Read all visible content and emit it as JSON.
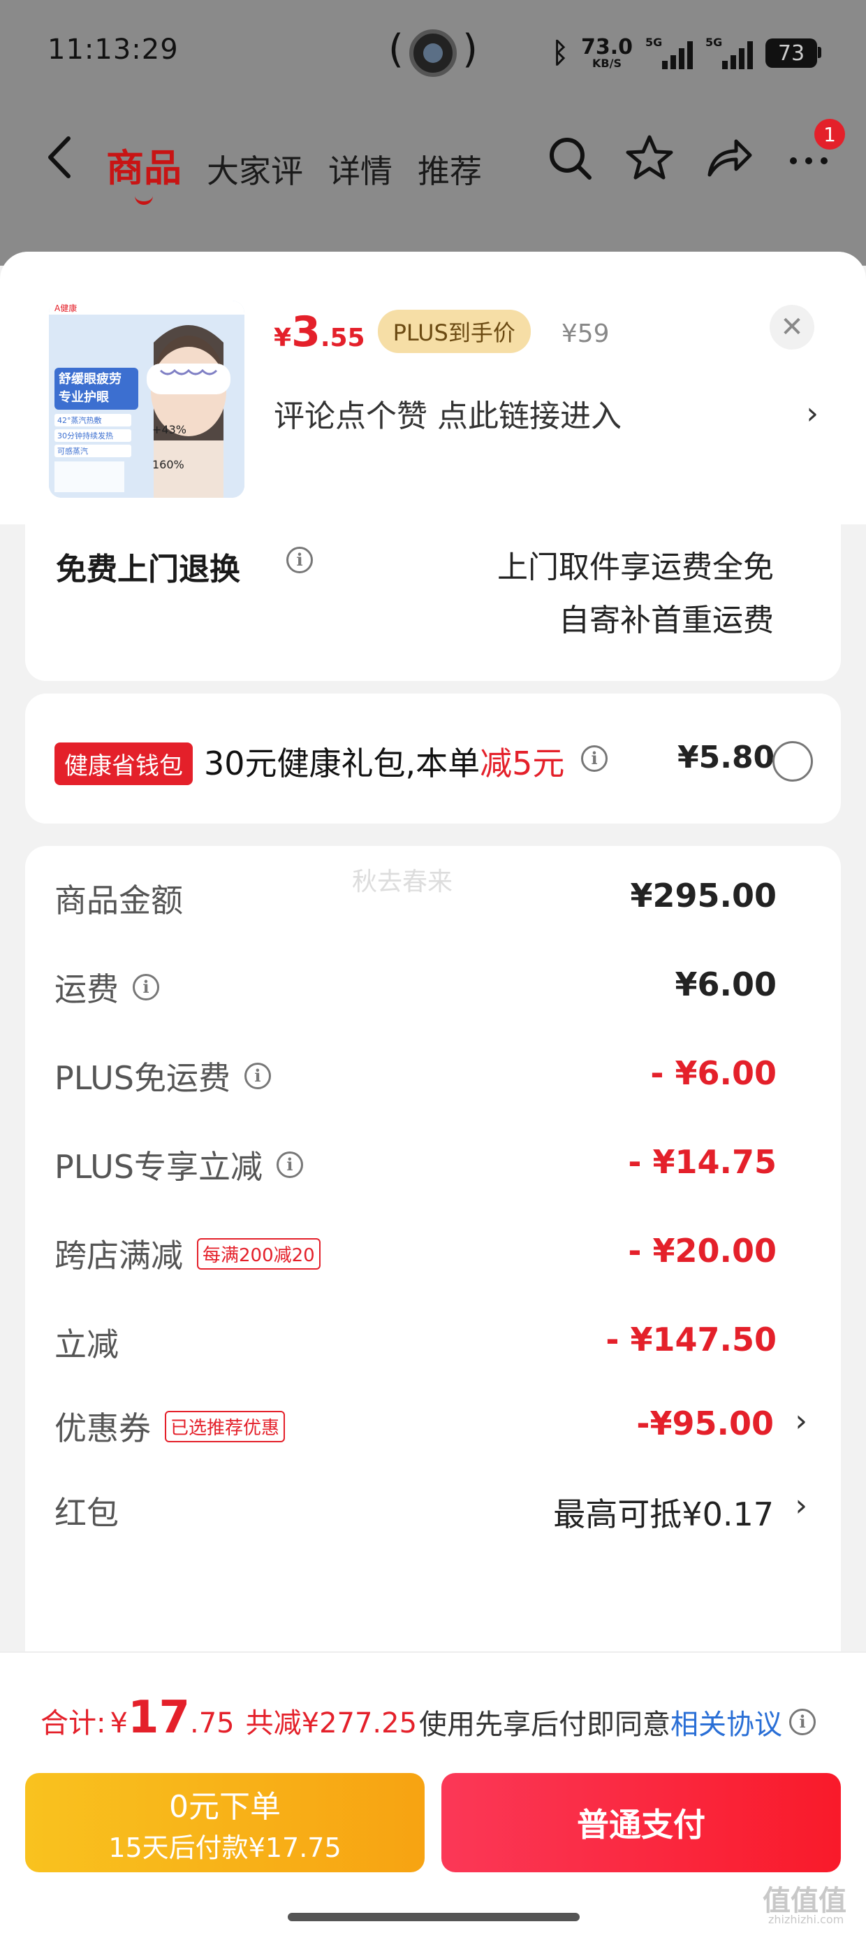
{
  "status": {
    "time": "11:13:29",
    "net_speed": "73.0",
    "net_unit": "KB/S",
    "signal1_label": "5G",
    "signal2_label": "5G",
    "battery": "73"
  },
  "nav": {
    "tabs": [
      {
        "label": "商品",
        "active": true
      },
      {
        "label": "大家评",
        "active": false
      },
      {
        "label": "详情",
        "active": false
      },
      {
        "label": "推荐",
        "active": false
      }
    ],
    "badge_count": "1",
    "icons": [
      "back-icon",
      "search-icon",
      "star-icon",
      "share-icon",
      "more-icon"
    ]
  },
  "product": {
    "price_symbol": "¥",
    "price_int": "3",
    "price_dec": ".55",
    "plus_tag": "PLUS到手价",
    "orig_price": "¥59",
    "comment_text": "评论点个赞  点此链接进入",
    "thumb_brand": "A健康",
    "thumb_title_1": "舒缓眼疲劳",
    "thumb_title_2": "专业护眼",
    "thumb_feature_1": "42°蒸汽热敷",
    "thumb_feature_2": "30分钟持续发热",
    "thumb_feature_3": "可感蒸汽",
    "thumb_stat_1": "+43%",
    "thumb_stat_2": "160%"
  },
  "returns": {
    "label": "免费上门退换",
    "line1": "上门取件享运费全免",
    "line2": "自寄补首重运费"
  },
  "wallet": {
    "tag": "健康省钱包",
    "text_prefix": "30元健康礼包,本单",
    "text_red": "减5元",
    "price": "¥5.80"
  },
  "summary": {
    "watermark": "秋去春来",
    "rows": [
      {
        "label": "商品金额",
        "value": "¥295.00"
      },
      {
        "label": "运费",
        "value": "¥6.00"
      },
      {
        "label": "PLUS免运费",
        "value": "- ¥6.00"
      },
      {
        "label": "PLUS专享立减",
        "value": "- ¥14.75"
      },
      {
        "label": "跨店满减",
        "tag": "每满200减20",
        "value": "- ¥20.00"
      },
      {
        "label": "立减",
        "value": "- ¥147.50"
      },
      {
        "label": "优惠券",
        "tag": "已选推荐优惠",
        "value": "-¥95.00"
      },
      {
        "label": "红包",
        "value": "最高可抵¥0.17"
      }
    ]
  },
  "bottom": {
    "total_label": "合计:",
    "total_symbol": "¥",
    "total_int": "17",
    "total_dec": ".75",
    "total_saved": "共减¥277.25",
    "agree_text": "使用先享后付即同意",
    "agree_link": "相关协议",
    "btn_zero_line1": "0元下单",
    "btn_zero_line2": "15天后付款¥17.75",
    "btn_pay": "普通支付",
    "site_mark": "值值值",
    "site_url": "zhizhizhi.com"
  },
  "colors": {
    "brand_red": "#e4202a",
    "plus_gold": "#f6dea6",
    "link_blue": "#2a6fd6",
    "zero_btn": "#f9b219",
    "pay_btn": "#fb2a40"
  }
}
